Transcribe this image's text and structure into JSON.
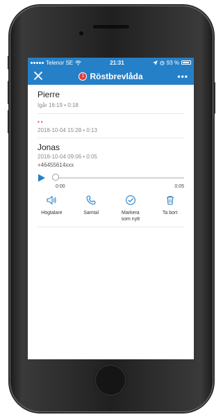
{
  "status_bar": {
    "carrier": "Telenor SE",
    "time": "21:31",
    "battery": "93 %"
  },
  "nav": {
    "badge": "1",
    "title": "Röstbrevlåda",
    "more": "•••"
  },
  "messages": [
    {
      "name": "Pierre",
      "meta": "Igår 16:19 • 0:18"
    },
    {
      "name": "••",
      "meta": "2018-10-04 15:28 • 0:13"
    },
    {
      "name": "Jonas",
      "meta": "2018-10-04 09:06 • 0:05",
      "number": "+46455614xxx"
    }
  ],
  "player": {
    "position": "0:00",
    "duration": "0:05",
    "progress": 0.0
  },
  "actions": [
    {
      "label": "Högtalare",
      "icon": "speaker-icon"
    },
    {
      "label": "Samtal",
      "icon": "phone-icon"
    },
    {
      "label": "Markera\nsom nytt",
      "icon": "check-circle-icon"
    },
    {
      "label": "Ta bort",
      "icon": "trash-icon"
    }
  ],
  "colors": {
    "accent": "#2680c7",
    "badge": "#e23a3a"
  }
}
